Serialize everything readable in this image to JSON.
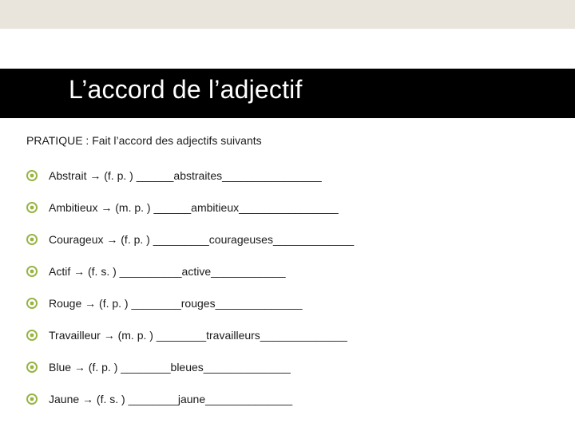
{
  "colors": {
    "accent": "#99b444",
    "title_bg": "#000000",
    "title_fg": "#ffffff",
    "top_strip": "#e9e5dc",
    "text": "#1a1a1a"
  },
  "title": "L’accord de l’adjectif",
  "subtitle": "PRATIQUE : Fait l’accord des adjectifs suivants",
  "items": [
    {
      "text": "Abstrait → (f. p. ) ______abstraites________________"
    },
    {
      "text": "Ambitieux → (m. p. ) ______ambitieux________________"
    },
    {
      "text": "Courageux → (f. p. ) _________courageuses_____________"
    },
    {
      "text": "Actif → (f. s. ) __________active____________"
    },
    {
      "text": "Rouge → (f. p. ) ________rouges______________"
    },
    {
      "text": "Travailleur → (m. p. ) ________travailleurs______________"
    },
    {
      "text": "Blue → (f. p. ) ________bleues______________"
    },
    {
      "text": "Jaune → (f. s. ) ________jaune______________"
    }
  ]
}
